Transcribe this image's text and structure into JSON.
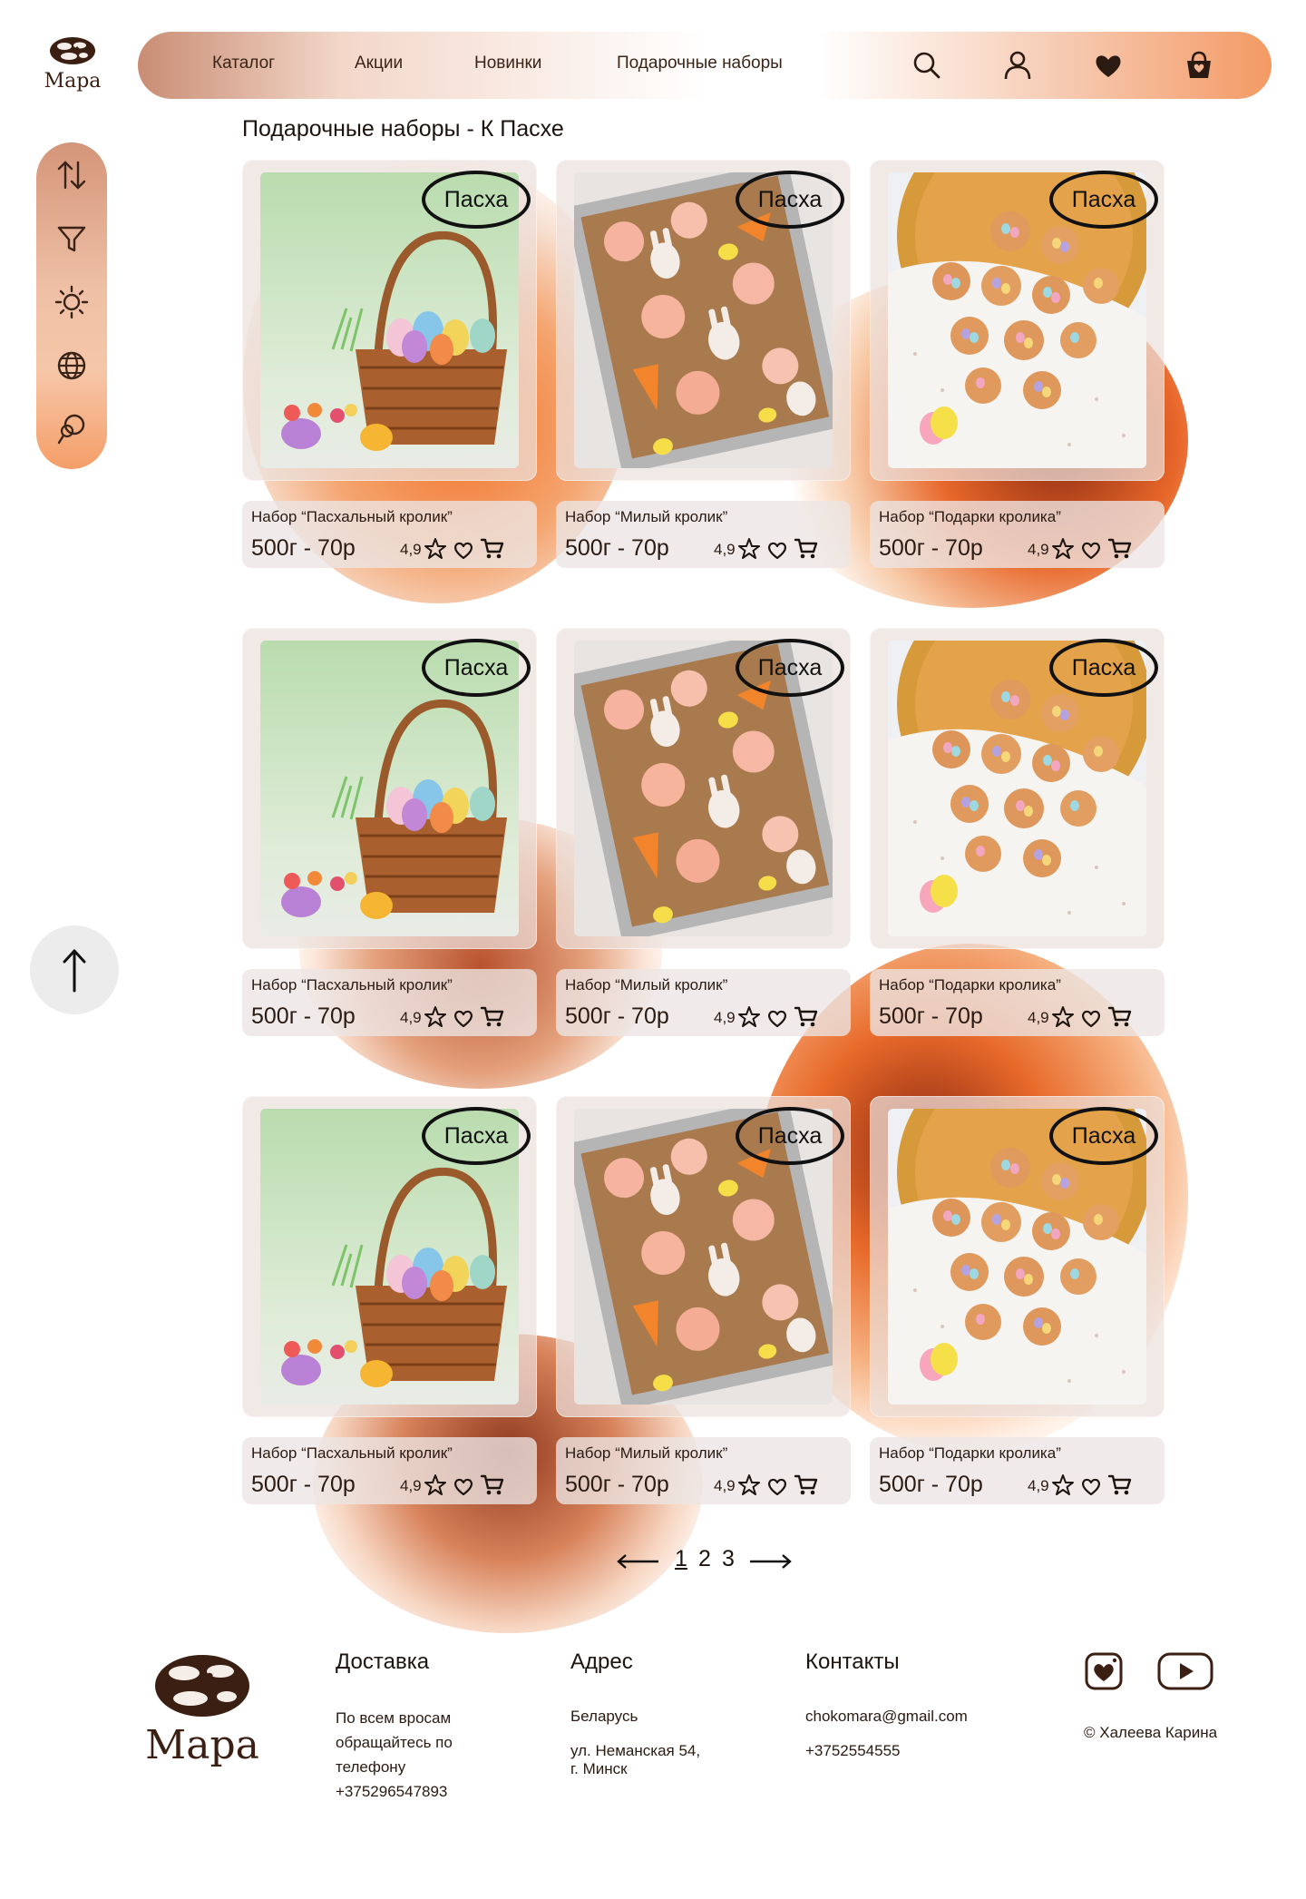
{
  "brand": {
    "name": "Мара"
  },
  "nav": {
    "links": [
      "Каталог",
      "Акции",
      "Новинки",
      "Подарочные наборы"
    ],
    "icons": [
      "search-icon",
      "user-icon",
      "heart-icon",
      "bag-icon"
    ]
  },
  "page": {
    "heading": "Подарочные наборы - К Пасхе"
  },
  "sidebar": {
    "icons": [
      "sort-icon",
      "filter-icon",
      "sun-icon",
      "globe-icon",
      "idea-icon"
    ]
  },
  "scroll_top": {
    "icon": "arrow-up-icon"
  },
  "products": [
    {
      "tag": "Пасха",
      "name": "Набор “Пасхальный кролик”",
      "price": "500г - 70р",
      "rating": "4,9",
      "image": "easter-basket"
    },
    {
      "tag": "Пасха",
      "name": "Набор “Милый кролик”",
      "price": "500г - 70р",
      "rating": "4,9",
      "image": "bunny-cookies"
    },
    {
      "tag": "Пасха",
      "name": "Набор “Подарки кролика”",
      "price": "500г - 70р",
      "rating": "4,9",
      "image": "nest-cookies"
    },
    {
      "tag": "Пасха",
      "name": "Набор “Пасхальный кролик”",
      "price": "500г - 70р",
      "rating": "4,9",
      "image": "easter-basket"
    },
    {
      "tag": "Пасха",
      "name": "Набор “Милый кролик”",
      "price": "500г - 70р",
      "rating": "4,9",
      "image": "bunny-cookies"
    },
    {
      "tag": "Пасха",
      "name": "Набор “Подарки кролика”",
      "price": "500г - 70р",
      "rating": "4,9",
      "image": "nest-cookies"
    },
    {
      "tag": "Пасха",
      "name": "Набор “Пасхальный кролик”",
      "price": "500г - 70р",
      "rating": "4,9",
      "image": "easter-basket"
    },
    {
      "tag": "Пасха",
      "name": "Набор “Милый кролик”",
      "price": "500г - 70р",
      "rating": "4,9",
      "image": "bunny-cookies"
    },
    {
      "tag": "Пасха",
      "name": "Набор “Подарки кролика”",
      "price": "500г - 70р",
      "rating": "4,9",
      "image": "nest-cookies"
    }
  ],
  "pagination": {
    "pages": [
      "1",
      "2",
      "3"
    ],
    "current": "1"
  },
  "footer": {
    "delivery": {
      "title": "Доставка",
      "lines": [
        "По всем вросам",
        "обращайтесь по",
        "телефону",
        "+375296547893"
      ]
    },
    "address": {
      "title": "Адрес",
      "lines": [
        "Беларусь",
        "ул. Неманская 54,",
        "г. Минск"
      ]
    },
    "contacts": {
      "title": "Контакты",
      "email": "chokomara@gmail.com",
      "phone": "+3752554555"
    },
    "social": [
      "instagram-icon",
      "youtube-icon"
    ],
    "copyright": "© Халеева Карина"
  },
  "colors": {
    "accent": "#f06a1c",
    "dark_brown": "#3b1f12",
    "text": "#2a1a12"
  }
}
